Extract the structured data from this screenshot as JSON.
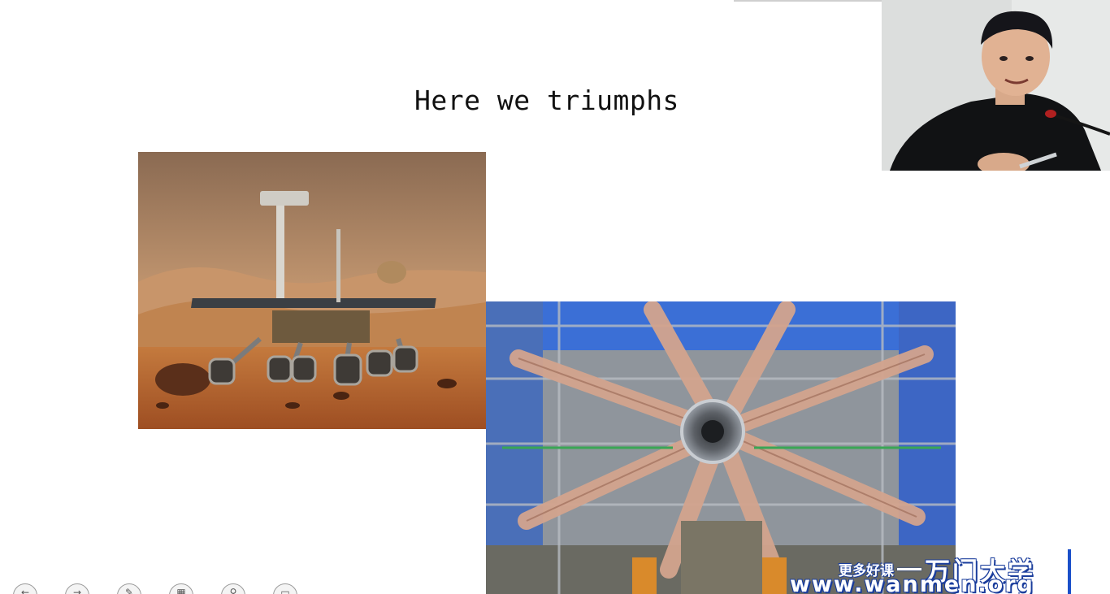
{
  "slide": {
    "title": "Here we triumphs"
  },
  "watermark": {
    "tagline": "更多好课",
    "brand": "万门大学",
    "url": "www.wanmen.org",
    "accent_color": "#1a3d9c"
  },
  "toolbar": {
    "buttons": [
      {
        "icon": "previous-arrow-icon",
        "glyph": "←"
      },
      {
        "icon": "next-arrow-icon",
        "glyph": "→"
      },
      {
        "icon": "pen-icon",
        "glyph": "✎"
      },
      {
        "icon": "slides-grid-icon",
        "glyph": "▦"
      },
      {
        "icon": "zoom-icon",
        "glyph": "⚲"
      },
      {
        "icon": "more-options-icon",
        "glyph": "▭"
      }
    ]
  },
  "images": {
    "rover": "mars-rover-photo",
    "detector": "particle-detector-photo",
    "webcam": "presenter-webcam-feed"
  }
}
